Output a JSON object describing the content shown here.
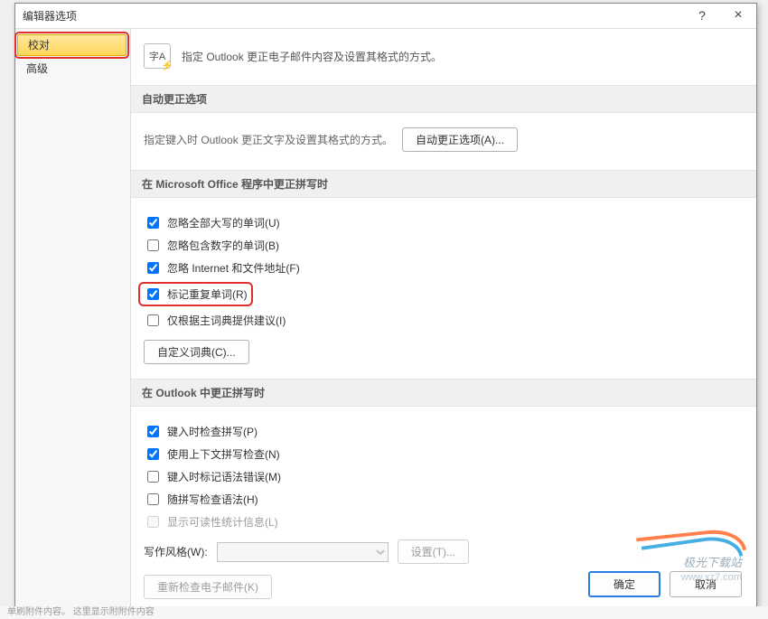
{
  "title": "编辑器选项",
  "sidebar": {
    "items": [
      {
        "label": "校对",
        "selected": true,
        "highlighted": true
      },
      {
        "label": "高级",
        "selected": false,
        "highlighted": false
      }
    ]
  },
  "intro": {
    "icon_text": "字A",
    "text": "指定 Outlook 更正电子邮件内容及设置其格式的方式。"
  },
  "sections": {
    "autocorrect": {
      "title": "自动更正选项",
      "hint": "指定键入时 Outlook 更正文字及设置其格式的方式。",
      "button": "自动更正选项(A)..."
    },
    "office_spelling": {
      "title": "在 Microsoft Office 程序中更正拼写时",
      "items": [
        {
          "label": "忽略全部大写的单词(U)",
          "checked": true,
          "disabled": false,
          "highlighted": false
        },
        {
          "label": "忽略包含数字的单词(B)",
          "checked": false,
          "disabled": false,
          "highlighted": false
        },
        {
          "label": "忽略 Internet 和文件地址(F)",
          "checked": true,
          "disabled": false,
          "highlighted": false
        },
        {
          "label": "标记重复单词(R)",
          "checked": true,
          "disabled": false,
          "highlighted": true
        },
        {
          "label": "仅根据主词典提供建议(I)",
          "checked": false,
          "disabled": false,
          "highlighted": false
        }
      ],
      "custom_dict_button": "自定义词典(C)..."
    },
    "outlook_spelling": {
      "title": "在 Outlook 中更正拼写时",
      "items": [
        {
          "label": "键入时检查拼写(P)",
          "checked": true,
          "disabled": false
        },
        {
          "label": "使用上下文拼写检查(N)",
          "checked": true,
          "disabled": false
        },
        {
          "label": "键入时标记语法错误(M)",
          "checked": false,
          "disabled": false
        },
        {
          "label": "随拼写检查语法(H)",
          "checked": false,
          "disabled": false
        },
        {
          "label": "显示可读性统计信息(L)",
          "checked": false,
          "disabled": true
        }
      ],
      "writing_style_label": "写作风格(W):",
      "writing_style_value": "",
      "settings_button": "设置(T)...",
      "recheck_button": "重新检查电子邮件(K)"
    }
  },
  "footer": {
    "ok": "确定",
    "cancel": "取消"
  },
  "watermark": {
    "brand": "极光下载站",
    "url": "www.xz7.com"
  },
  "bottom_strip": "单刷附件内容。  这里显示附附件内容"
}
